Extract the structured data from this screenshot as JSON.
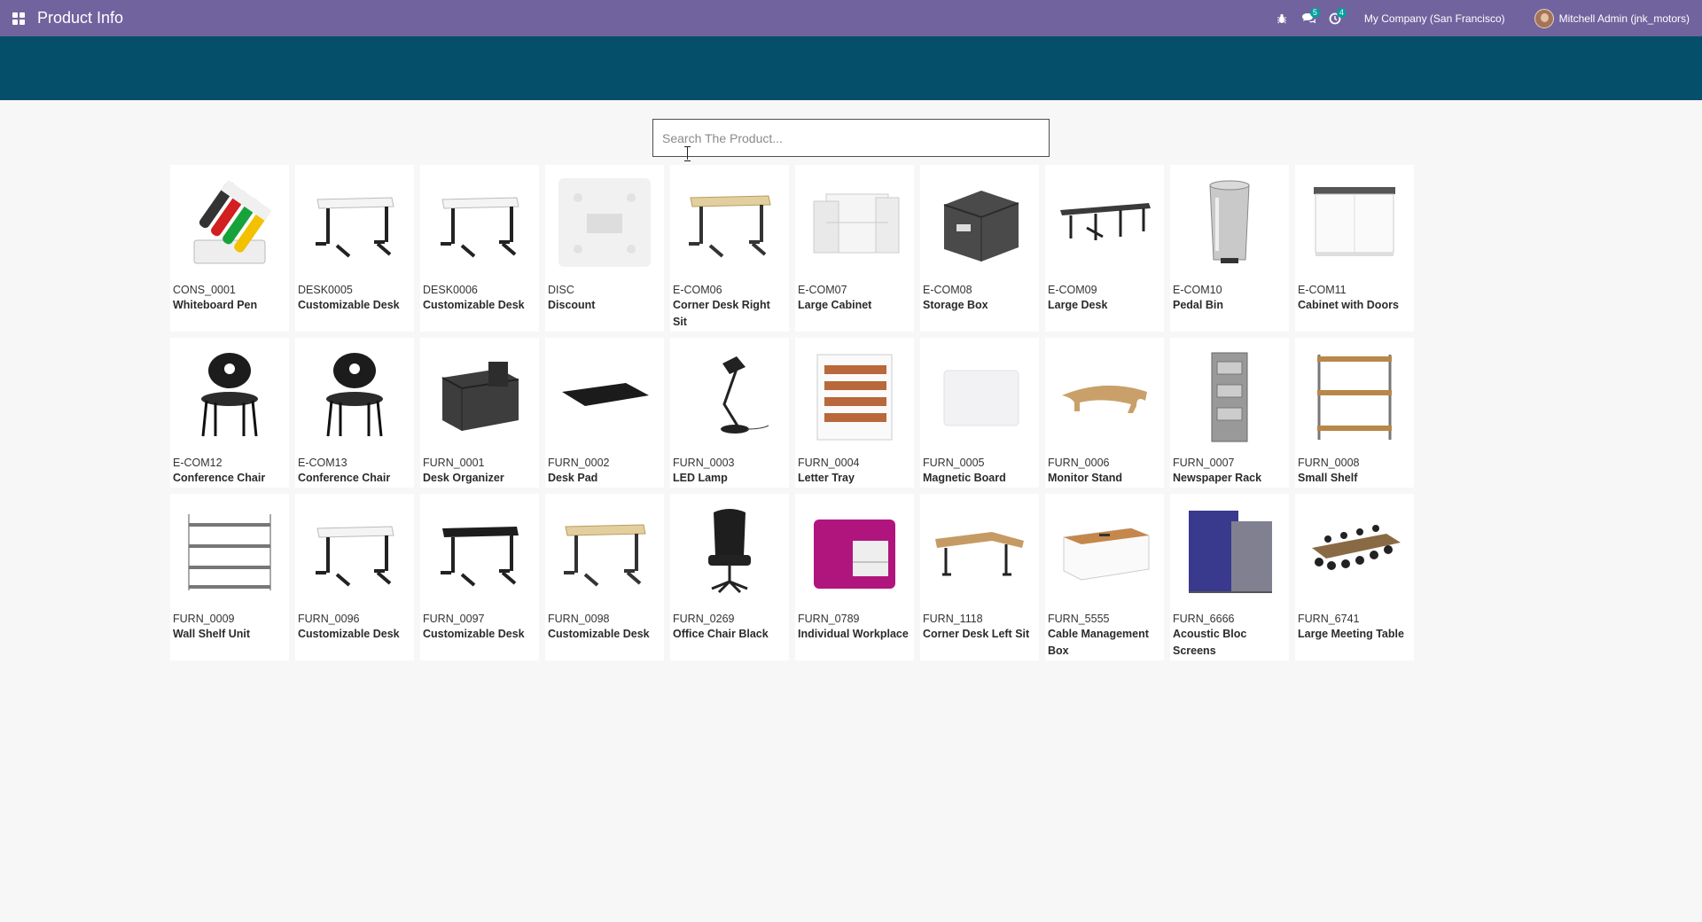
{
  "navbar": {
    "app_title": "Product Info",
    "company": "My Company (San Francisco)",
    "user": "Mitchell Admin (jnk_motors)",
    "messages_badge": "5",
    "activities_badge": "4",
    "icons": [
      "apps-grid-icon",
      "bug-icon",
      "chat-icon",
      "clock-icon"
    ]
  },
  "search": {
    "placeholder": "Search The Product...",
    "value": ""
  },
  "colors": {
    "navbar": "#71639e",
    "banner": "#054f6b",
    "badge": "#00a09d"
  },
  "products": [
    {
      "code": "CONS_0001",
      "name": "Whiteboard Pen",
      "image": "pens"
    },
    {
      "code": "DESK0005",
      "name": "Customizable Desk",
      "image": "desk-white"
    },
    {
      "code": "DESK0006",
      "name": "Customizable Desk",
      "image": "desk-white"
    },
    {
      "code": "DISC",
      "name": "Discount",
      "image": "placeholder"
    },
    {
      "code": "E-COM06",
      "name": "Corner Desk Right Sit",
      "image": "desk-beige"
    },
    {
      "code": "E-COM07",
      "name": "Large Cabinet",
      "image": "cabinet"
    },
    {
      "code": "E-COM08",
      "name": "Storage Box",
      "image": "storage-box"
    },
    {
      "code": "E-COM09",
      "name": "Large Desk",
      "image": "large-desk"
    },
    {
      "code": "E-COM10",
      "name": "Pedal Bin",
      "image": "pedal-bin"
    },
    {
      "code": "E-COM11",
      "name": "Cabinet with Doors",
      "image": "cabinet-doors"
    },
    {
      "code": "E-COM12",
      "name": "Conference Chair",
      "image": "chair"
    },
    {
      "code": "E-COM13",
      "name": "Conference Chair",
      "image": "chair"
    },
    {
      "code": "FURN_0001",
      "name": "Desk Organizer",
      "image": "organizer"
    },
    {
      "code": "FURN_0002",
      "name": "Desk Pad",
      "image": "desk-pad"
    },
    {
      "code": "FURN_0003",
      "name": "LED Lamp",
      "image": "lamp"
    },
    {
      "code": "FURN_0004",
      "name": "Letter Tray",
      "image": "letter-tray"
    },
    {
      "code": "FURN_0005",
      "name": "Magnetic Board",
      "image": "board"
    },
    {
      "code": "FURN_0006",
      "name": "Monitor Stand",
      "image": "monitor-stand"
    },
    {
      "code": "FURN_0007",
      "name": "Newspaper Rack",
      "image": "rack"
    },
    {
      "code": "FURN_0008",
      "name": "Small Shelf",
      "image": "small-shelf"
    },
    {
      "code": "FURN_0009",
      "name": "Wall Shelf Unit",
      "image": "wall-shelf"
    },
    {
      "code": "FURN_0096",
      "name": "Customizable Desk",
      "image": "desk-white"
    },
    {
      "code": "FURN_0097",
      "name": "Customizable Desk",
      "image": "desk-black"
    },
    {
      "code": "FURN_0098",
      "name": "Customizable Desk",
      "image": "desk-beige"
    },
    {
      "code": "FURN_0269",
      "name": "Office Chair Black",
      "image": "office-chair"
    },
    {
      "code": "FURN_0789",
      "name": "Individual Workplace",
      "image": "workplace"
    },
    {
      "code": "FURN_1118",
      "name": "Corner Desk Left Sit",
      "image": "corner-desk"
    },
    {
      "code": "FURN_5555",
      "name": "Cable Management Box",
      "image": "cable-box"
    },
    {
      "code": "FURN_6666",
      "name": "Acoustic Bloc Screens",
      "image": "screens"
    },
    {
      "code": "FURN_6741",
      "name": "Large Meeting Table",
      "image": "meeting-table"
    }
  ]
}
